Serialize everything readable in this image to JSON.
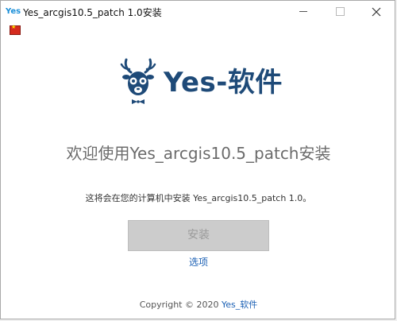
{
  "window": {
    "app_icon_text": "Yes",
    "title": "Yes_arcgis10.5_patch 1.0安装"
  },
  "brand": {
    "name": "Yes-软件",
    "color": "#1e4a78"
  },
  "main": {
    "headline": "欢迎使用Yes_arcgis10.5_patch安装",
    "description": "这将会在您的计算机中安装 Yes_arcgis10.5_patch 1.0。",
    "install_button_label": "安装",
    "options_link_label": "选项"
  },
  "footer": {
    "copyright": "Copyright © 2020 ",
    "brand_link": "Yes_软件"
  },
  "icons": {
    "language": "china-flag-icon",
    "logo": "deer-logo-icon"
  }
}
